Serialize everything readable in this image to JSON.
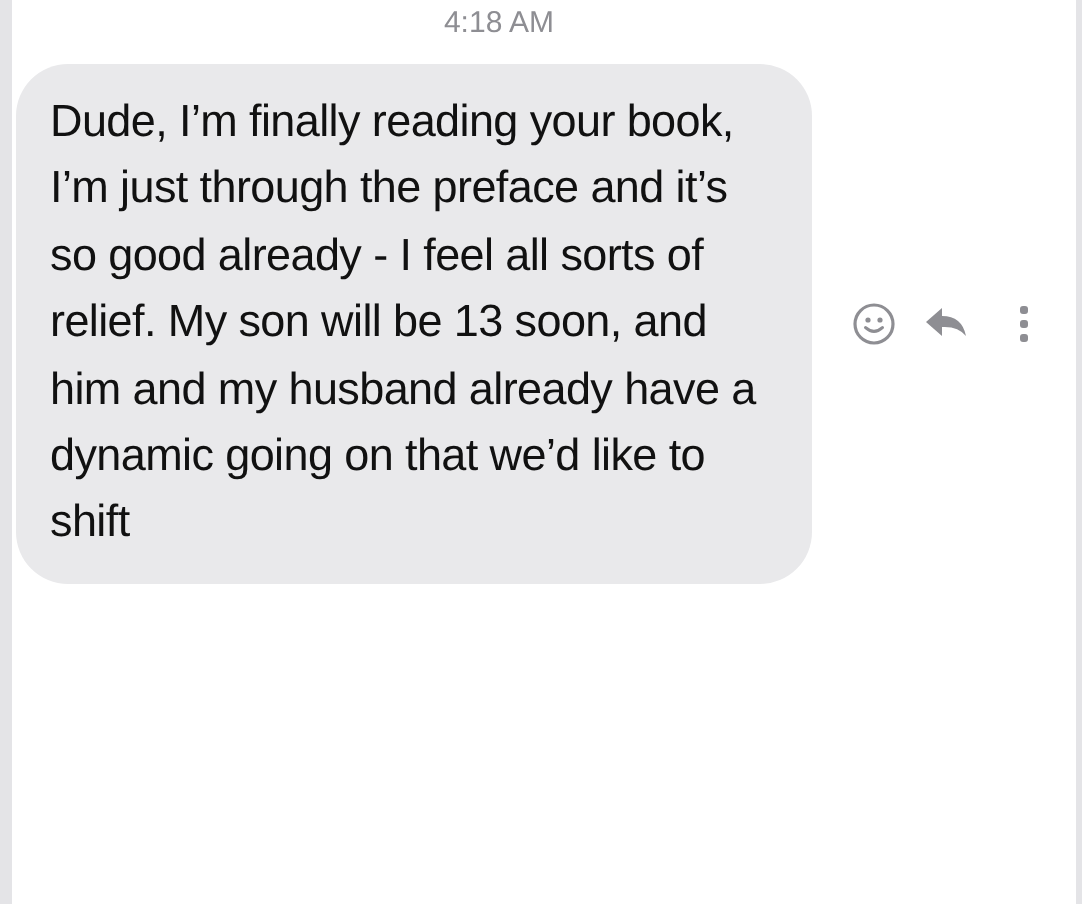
{
  "timestamp": "4:18 AM",
  "message": {
    "text": "Dude, I’m finally reading your book, I’m just through the preface and it’s so good already - I feel all sorts of relief. My son will be 13 soon, and him and my husband already have a dynamic going on that we’d like to shift"
  }
}
